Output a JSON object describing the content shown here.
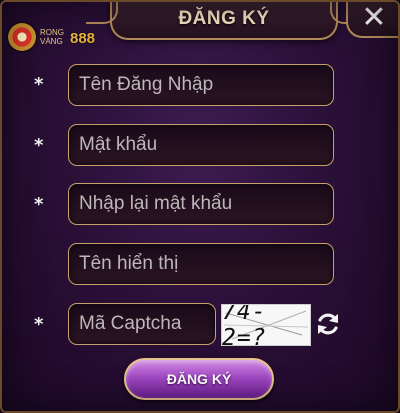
{
  "dialog": {
    "title": "ĐĂNG KÝ",
    "close_label": "✕"
  },
  "logo": {
    "text_top": "RONG",
    "text_bottom": "VÀNG",
    "text_number": "888"
  },
  "form": {
    "required_marker": "*",
    "username_placeholder": "Tên Đăng Nhập",
    "password_placeholder": "Mật khẩu",
    "password_confirm_placeholder": "Nhập lại mật khẩu",
    "display_name_placeholder": "Tên hiển thị",
    "captcha_placeholder": "Mã Captcha",
    "captcha_text": "74-2=?",
    "submit_label": "ĐĂNG KÝ"
  },
  "colors": {
    "accent_gold": "#c9a06a",
    "button_purple": "#a14ac4",
    "background": "#2b1038"
  },
  "icons": {
    "close": "close-icon",
    "refresh": "refresh-icon",
    "logo": "logo-icon"
  }
}
